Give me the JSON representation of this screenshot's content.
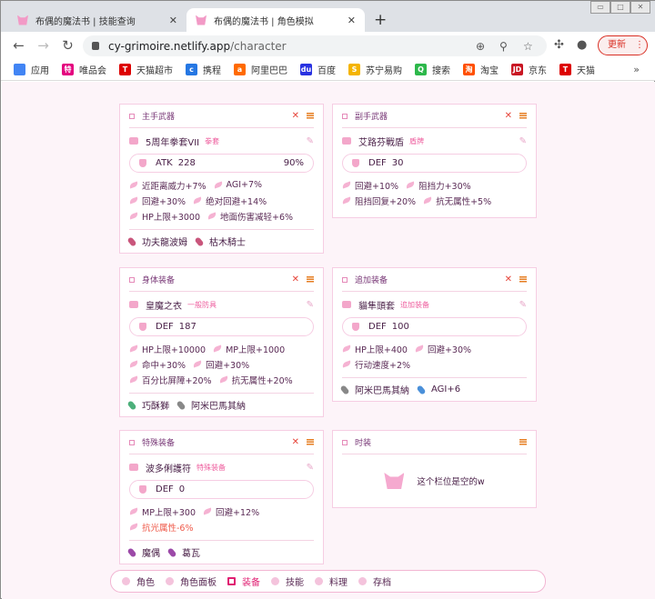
{
  "browser": {
    "tabs": [
      {
        "title": "布偶的魔法书 | 技能查询"
      },
      {
        "title": "布偶的魔法书 | 角色模拟"
      }
    ],
    "url_host": "cy-grimoire.netlify.app",
    "url_path": "/character",
    "update_label": "更新",
    "bookmarks": [
      {
        "label": "应用",
        "color": "#4285f4",
        "glyph": ""
      },
      {
        "label": "唯品会",
        "color": "#e4007f",
        "glyph": "特"
      },
      {
        "label": "天猫超市",
        "color": "#d00",
        "glyph": "T"
      },
      {
        "label": "携程",
        "color": "#2577e3",
        "glyph": "c"
      },
      {
        "label": "阿里巴巴",
        "color": "#ff6a00",
        "glyph": "a"
      },
      {
        "label": "百度",
        "color": "#2932e1",
        "glyph": "du"
      },
      {
        "label": "苏宁易购",
        "color": "#f4b400",
        "glyph": "S"
      },
      {
        "label": "搜索",
        "color": "#2db84b",
        "glyph": "Q"
      },
      {
        "label": "淘宝",
        "color": "#ff5000",
        "glyph": "淘"
      },
      {
        "label": "京东",
        "color": "#c91623",
        "glyph": "JD"
      },
      {
        "label": "天猫",
        "color": "#d00",
        "glyph": "T"
      }
    ]
  },
  "cards": [
    {
      "title": "主手武器",
      "closable": true,
      "name": "5周年拳套VII",
      "type": "拳套",
      "stat": "ATK",
      "value": "228",
      "refine": "90%",
      "abilities": [
        {
          "t": "近距离威力+7%"
        },
        {
          "t": "AGI+7%"
        },
        {
          "t": "回避+30%"
        },
        {
          "t": "绝对回避+14%"
        },
        {
          "t": "HP上限+3000"
        },
        {
          "t": "地面伤害减轻+6%"
        }
      ],
      "crystals": [
        {
          "t": "功夫龍波姆",
          "c": "#c9567c"
        },
        {
          "t": "枯木騎士",
          "c": "#c9567c"
        }
      ]
    },
    {
      "title": "副手武器",
      "closable": true,
      "name": "艾路芬戰盾",
      "type": "盾牌",
      "stat": "DEF",
      "value": "30",
      "abilities": [
        {
          "t": "回避+10%"
        },
        {
          "t": "阻挡力+30%"
        },
        {
          "t": "阻挡回复+20%"
        },
        {
          "t": "抗无属性+5%"
        }
      ],
      "crystals": []
    },
    {
      "title": "身体装备",
      "closable": true,
      "name": "皇魔之衣",
      "type": "一般防具",
      "stat": "DEF",
      "value": "187",
      "abilities": [
        {
          "t": "HP上限+10000"
        },
        {
          "t": "MP上限+1000"
        },
        {
          "t": "命中+30%"
        },
        {
          "t": "回避+30%"
        },
        {
          "t": "百分比屏障+20%"
        },
        {
          "t": "抗无属性+20%"
        }
      ],
      "crystals": [
        {
          "t": "巧酥獅",
          "c": "#4caf7a"
        },
        {
          "t": "阿米巴馬其納",
          "c": "#888"
        }
      ]
    },
    {
      "title": "追加装备",
      "closable": true,
      "name": "貓隼頭套",
      "type": "追加装备",
      "stat": "DEF",
      "value": "100",
      "abilities": [
        {
          "t": "HP上限+400"
        },
        {
          "t": "回避+30%"
        },
        {
          "t": "行动速度+2%"
        }
      ],
      "crystals": [
        {
          "t": "阿米巴馬其納",
          "c": "#888"
        },
        {
          "t": "AGI+6",
          "c": "#4a90d9"
        }
      ]
    },
    {
      "title": "特殊装备",
      "closable": true,
      "name": "波多俐護符",
      "type": "特殊装备",
      "stat": "DEF",
      "value": "0",
      "abilities": [
        {
          "t": "MP上限+300"
        },
        {
          "t": "回避+12%"
        },
        {
          "t": "抗光属性-6%",
          "neg": true
        }
      ],
      "crystals": [
        {
          "t": "魔偶",
          "c": "#9c4aa8"
        },
        {
          "t": "葛瓦",
          "c": "#9c4aa8"
        }
      ]
    },
    {
      "title": "时装",
      "closable": false,
      "empty": "这个栏位是空的w"
    }
  ],
  "bottom_nav": [
    {
      "label": "角色"
    },
    {
      "label": "角色面板"
    },
    {
      "label": "装备",
      "active": true
    },
    {
      "label": "技能"
    },
    {
      "label": "料理"
    },
    {
      "label": "存档"
    }
  ]
}
